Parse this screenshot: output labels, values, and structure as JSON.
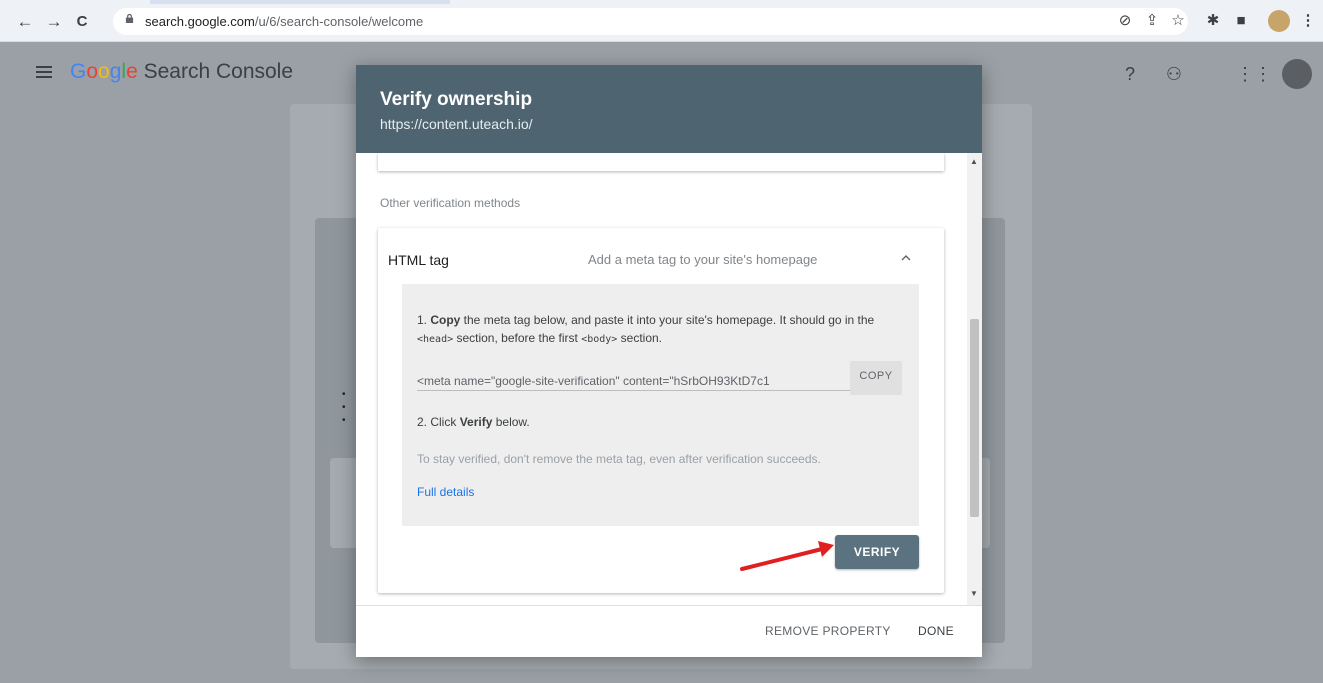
{
  "browser": {
    "url_host": "search.google.com",
    "url_path": "/u/6/search-console/welcome"
  },
  "app": {
    "logo_letters": [
      "G",
      "o",
      "o",
      "g",
      "l",
      "e"
    ],
    "product_name": "Search Console"
  },
  "dialog": {
    "title": "Verify ownership",
    "subtitle": "https://content.uteach.io/",
    "other_methods_label": "Other verification methods",
    "method": {
      "title": "HTML tag",
      "description": "Add a meta tag to your site's homepage",
      "step1_prefix": "1. ",
      "step1_bold": "Copy",
      "step1_rest": " the meta tag below, and paste it into your site's homepage. It should go in the ",
      "step1_code1": "<head>",
      "step1_mid": " section, before the first ",
      "step1_code2": "<body>",
      "step1_end": " section.",
      "meta_tag_value": "<meta name=\"google-site-verification\" content=\"hSrbOH93KtD7c1",
      "copy_label": "COPY",
      "step2_prefix": "2. Click ",
      "step2_bold": "Verify",
      "step2_rest": " below.",
      "note": "To stay verified, don't remove the meta tag, even after verification succeeds.",
      "full_details_label": "Full details",
      "verify_label": "VERIFY"
    },
    "footer": {
      "remove_label": "REMOVE PROPERTY",
      "done_label": "DONE"
    }
  },
  "colors": {
    "dialog_header": "#4e6470",
    "verify_button": "#5b7380",
    "link": "#1a73e8",
    "annotation_arrow": "#e02020"
  }
}
